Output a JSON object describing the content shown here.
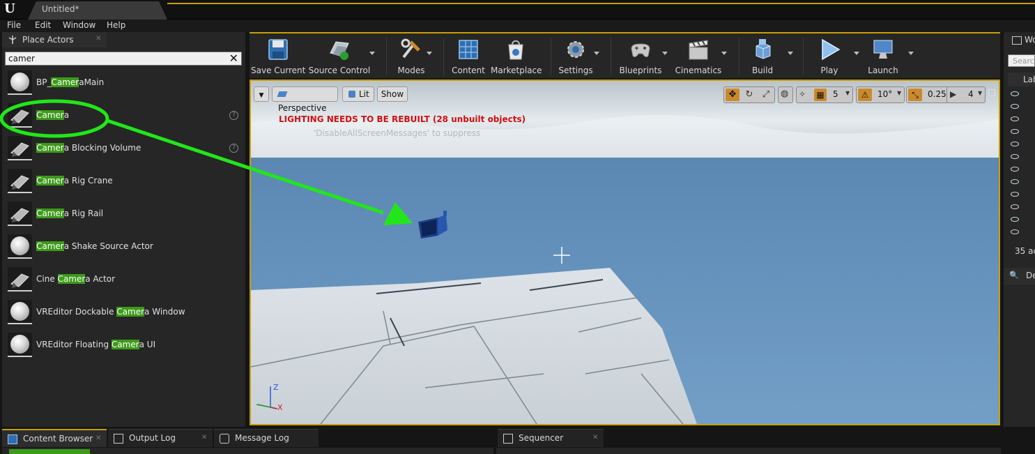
{
  "window": {
    "doc_tab": "Untitled*",
    "accent": "#c8a000"
  },
  "menu": [
    "File",
    "Edit",
    "Window",
    "Help"
  ],
  "place_actors": {
    "tab_label": "Place Actors",
    "search_value": "camer",
    "highlight_color": "#3d9a1a",
    "items": [
      {
        "pre": "BP_",
        "hl": "Camer",
        "post": "aMain",
        "help": false
      },
      {
        "pre": "",
        "hl": "Camer",
        "post": "a",
        "help": true
      },
      {
        "pre": "",
        "hl": "Camer",
        "post": "a Blocking Volume",
        "help": true
      },
      {
        "pre": "",
        "hl": "Camer",
        "post": "a Rig Crane",
        "help": false
      },
      {
        "pre": "",
        "hl": "Camer",
        "post": "a Rig Rail",
        "help": false
      },
      {
        "pre": "",
        "hl": "Camer",
        "post": "a Shake Source Actor",
        "help": false
      },
      {
        "pre": "Cine ",
        "hl": "Camer",
        "post": "a Actor",
        "help": false
      },
      {
        "pre": "VREditor Dockable ",
        "hl": "Camer",
        "post": "a Window",
        "help": false
      },
      {
        "pre": "VREditor Floating ",
        "hl": "Camer",
        "post": "a UI",
        "help": false
      }
    ]
  },
  "toolbar": {
    "save_current": "Save Current",
    "source_control": "Source Control",
    "modes": "Modes",
    "content": "Content",
    "marketplace": "Marketplace",
    "settings": "Settings",
    "blueprints": "Blueprints",
    "cinematics": "Cinematics",
    "build": "Build",
    "play": "Play",
    "launch": "Launch"
  },
  "viewport": {
    "perspective": "Perspective",
    "lit": "Lit",
    "show": "Show",
    "grid_snap": "5",
    "rotation_snap": "10°",
    "scale_snap": "0.25",
    "camera_speed": "4",
    "warning": "LIGHTING NEEDS TO BE REBUILT (28 unbuilt objects)",
    "suppress": "'DisableAllScreenMessages' to suppress",
    "axis_z": "Z",
    "axis_x": "X"
  },
  "right_panel": {
    "tab_fragment": "Wo",
    "search_fragment": "Search",
    "label_fragment": "Lab",
    "actors_count": "35 ac",
    "details_fragment": "De"
  },
  "bottom_tabs": {
    "content_browser": "Content Browser",
    "output_log": "Output Log",
    "message_log": "Message Log",
    "sequencer": "Sequencer"
  },
  "annotation_color": "#22e61a"
}
